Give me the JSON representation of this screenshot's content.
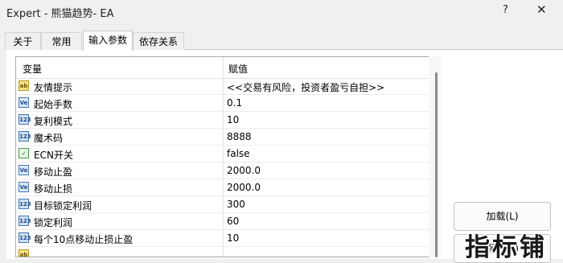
{
  "window": {
    "title": "Expert - 熊猫趋势- EA",
    "help_glyph": "?",
    "close_glyph": "✕"
  },
  "tabs": [
    {
      "label": "关于",
      "active": false
    },
    {
      "label": "常用",
      "active": false
    },
    {
      "label": "输入参数",
      "active": true
    },
    {
      "label": "依存关系",
      "active": false
    }
  ],
  "grid": {
    "header": {
      "variable": "变量",
      "value": "赋值"
    },
    "rows": [
      {
        "icon": "ab",
        "name": "友情提示",
        "value": "<<交易有风险，投资者盈亏自担>>"
      },
      {
        "icon": "ve",
        "name": "起始手数",
        "value": "0.1"
      },
      {
        "icon": "123",
        "name": "复利模式",
        "value": "10"
      },
      {
        "icon": "123",
        "name": "魔术码",
        "value": "8888"
      },
      {
        "icon": "tf",
        "name": "ECN开关",
        "value": "false"
      },
      {
        "icon": "ve",
        "name": "移动止盈",
        "value": "2000.0"
      },
      {
        "icon": "ve",
        "name": "移动止损",
        "value": "2000.0"
      },
      {
        "icon": "123",
        "name": "目标锁定利润",
        "value": "300"
      },
      {
        "icon": "123",
        "name": "锁定利润",
        "value": "60"
      },
      {
        "icon": "123",
        "name": "每个10点移动止损止盈",
        "value": "10"
      }
    ]
  },
  "buttons": {
    "load": "加载(L)",
    "save": "保存(S)"
  },
  "watermark": "指标铺"
}
